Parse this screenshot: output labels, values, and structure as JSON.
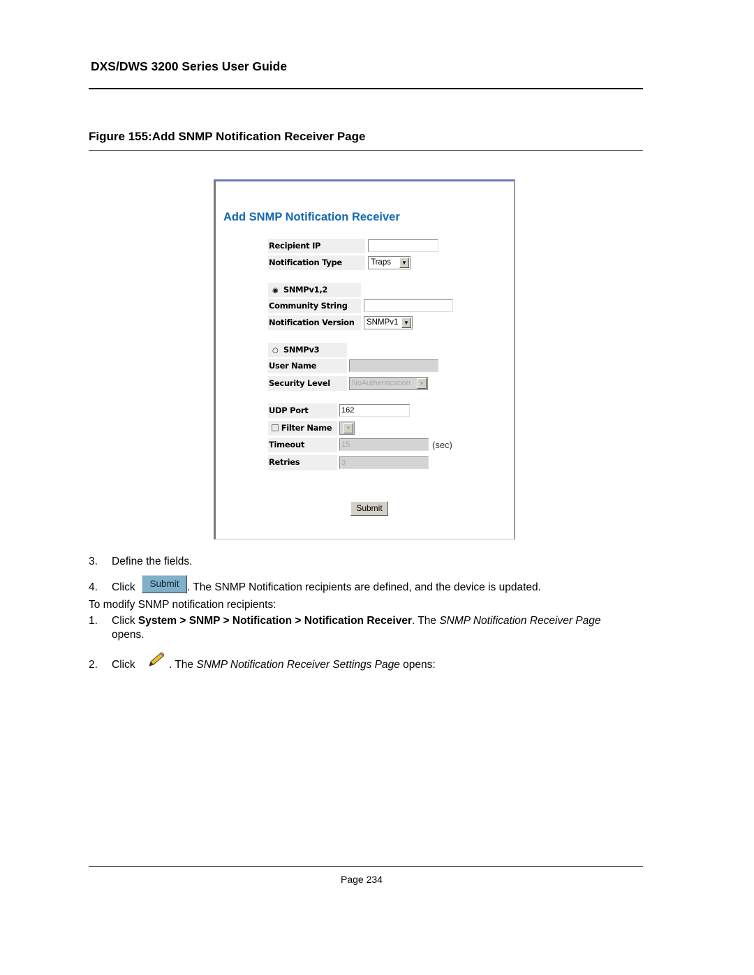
{
  "header": {
    "title": "DXS/DWS 3200 Series User Guide"
  },
  "figure": {
    "caption": "Figure 155:Add SNMP Notification Receiver Page"
  },
  "form": {
    "title": "Add SNMP Notification Receiver",
    "recipient_ip": {
      "label": "Recipient IP",
      "value": ""
    },
    "notification_type": {
      "label": "Notification Type",
      "value": "Traps"
    },
    "snmpv12": {
      "label": "SNMPv1,2",
      "selected": true
    },
    "community_string": {
      "label": "Community String",
      "value": ""
    },
    "notification_version": {
      "label": "Notification Version",
      "value": "SNMPv1"
    },
    "snmpv3": {
      "label": "SNMPv3",
      "selected": false
    },
    "user_name": {
      "label": "User Name",
      "value": ""
    },
    "security_level": {
      "label": "Security Level",
      "value": "NoAuthentication"
    },
    "udp_port": {
      "label": "UDP Port",
      "value": "162"
    },
    "filter_name": {
      "label": "Filter Name",
      "checked": false,
      "value": ""
    },
    "timeout": {
      "label": "Timeout",
      "value": "15",
      "unit": "(sec)"
    },
    "retries": {
      "label": "Retries",
      "value": "3"
    },
    "submit_label": "Submit"
  },
  "body": {
    "step3_num": "3.",
    "step3": "Define the fields.",
    "step4_num": "4.",
    "click": "Click",
    "submit_label": "Submit",
    "step4_rest": ". The SNMP Notification recipients are defined, and the device is updated.",
    "modify_intro": "To modify SNMP notification recipients:",
    "m1_num": "1.",
    "m1_path": "System > SNMP > Notification > Notification Receiver",
    "m1_the": ". The ",
    "m1_page": "SNMP Notification Receiver Page",
    "m1_opens": "opens.",
    "m2_num": "2.",
    "m2_the": ". The ",
    "m2_page": "SNMP Notification Receiver Settings Page",
    "m2_opens": " opens:",
    "edit_icon": "pencil-icon"
  },
  "footer": {
    "page": "Page 234"
  }
}
